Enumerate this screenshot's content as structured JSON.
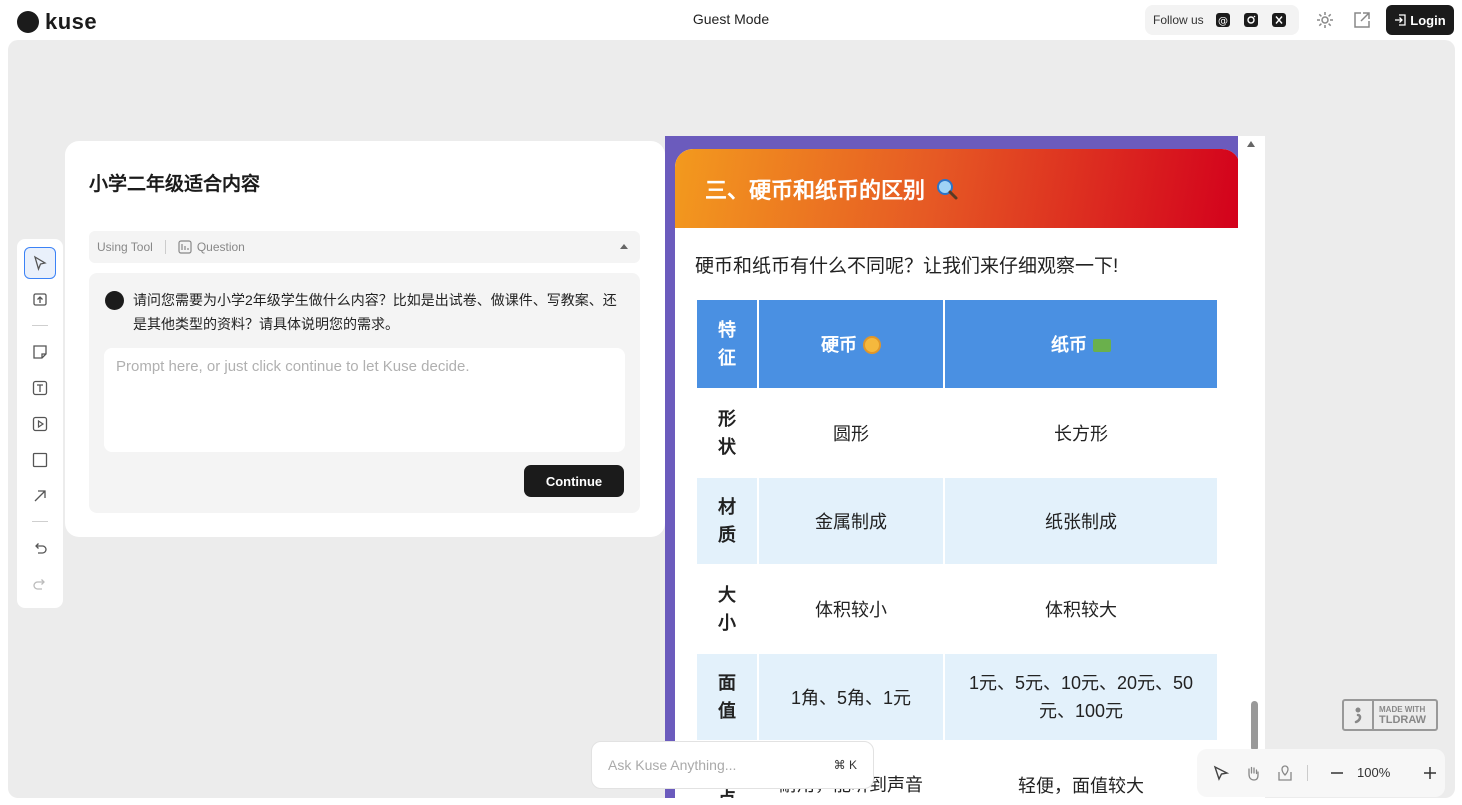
{
  "header": {
    "logo_text": "kuse",
    "mode": "Guest Mode",
    "follow_label": "Follow us",
    "socials": [
      "threads-icon",
      "instagram-icon",
      "x-icon"
    ],
    "login_label": "Login"
  },
  "toolbar": {
    "tools": [
      "select",
      "upload",
      "sticky-note",
      "text",
      "media",
      "rectangle",
      "arrow",
      "undo",
      "redo"
    ]
  },
  "card": {
    "title": "小学二年级适合内容",
    "tool_label": "Using Tool",
    "tool_name": "Question",
    "question": "请问您需要为小学2年级学生做什么内容？比如是出试卷、做课件、写教案、还是其他类型的资料？请具体说明您的需求。",
    "prompt_placeholder": "Prompt here, or just click continue to let Kuse decide.",
    "continue_label": "Continue"
  },
  "doc": {
    "heading": "三、硬币和纸币的区别",
    "subtitle": "硬币和纸币有什么不同呢？让我们来仔细观察一下!",
    "table": {
      "headers": [
        "特征",
        "硬币",
        "纸币"
      ],
      "rows": [
        [
          "形状",
          "圆形",
          "长方形"
        ],
        [
          "材质",
          "金属制成",
          "纸张制成"
        ],
        [
          "大小",
          "体积较小",
          "体积较大"
        ],
        [
          "面值",
          "1角、5角、1元",
          "1元、5元、10元、20元、50元、100元"
        ],
        [
          "特点",
          "耐用，能听到声音",
          "轻便，面值较大"
        ]
      ]
    }
  },
  "ask": {
    "placeholder": "Ask Kuse Anything...",
    "shortcut": "⌘ K"
  },
  "badge": {
    "line1": "MADE WITH",
    "line2": "TLDRAW"
  },
  "zoom": {
    "level": "100%"
  },
  "colors": {
    "accent": "#1b1b1b",
    "doc_frame": "#6b5bbd",
    "table_header": "#4a90e2",
    "table_alt_row": "#e3f1fb"
  }
}
